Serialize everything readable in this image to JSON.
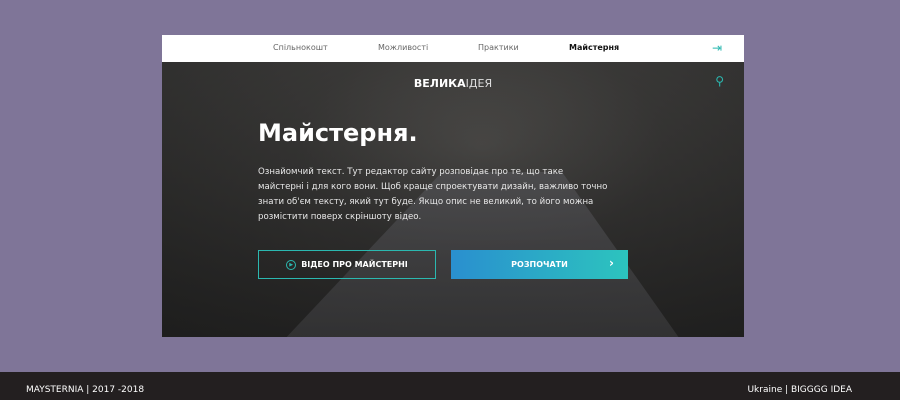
{
  "nav": {
    "items": [
      {
        "label": "Спільнокошт"
      },
      {
        "label": "Можливості"
      },
      {
        "label": "Практики"
      },
      {
        "label": "Майстерня",
        "active": true
      }
    ],
    "login_icon": "login-icon"
  },
  "hero": {
    "logo_bold": "ВЕЛИКА",
    "logo_light": "ІДЕЯ",
    "search_icon": "search-icon",
    "title": "Майстерня.",
    "description": "Ознайомчий текст. Тут редактор сайту розповідає про те, що таке майстерні і для кого вони. Щоб краще спроектувати дизайн, важливо точно знати об'єм тексту, який тут буде. Якщо опис не великий, то його можна розмістити поверх скріншоту відео.",
    "video_button": "ВІДЕО ПРО МАЙСТЕРНІ",
    "start_button": "РОЗПОЧАТИ"
  },
  "footer": {
    "left": "MAYSTERNIA | 2017 -2018",
    "right": "Ukraine | BIGGGG IDEA"
  },
  "colors": {
    "background": "#7f7598",
    "accent": "#2bb8b0",
    "footer": "#231f20"
  }
}
